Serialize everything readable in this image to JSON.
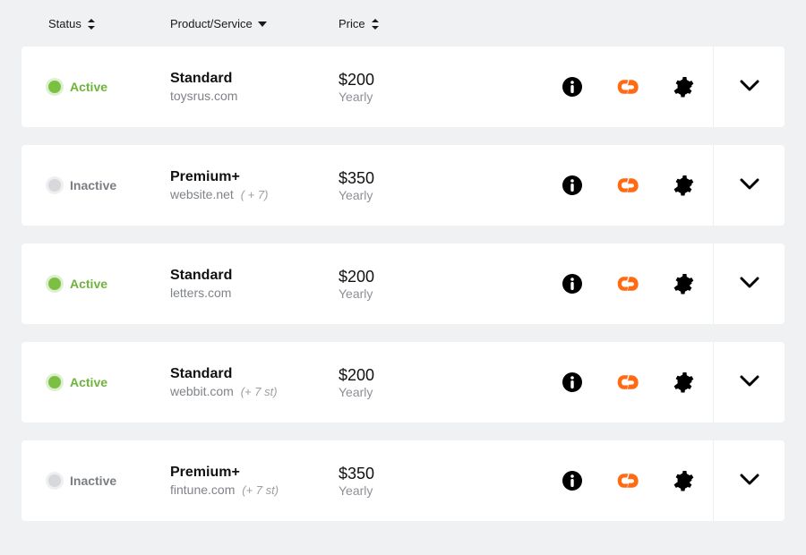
{
  "columns": {
    "status": "Status",
    "product": "Product/Service",
    "price": "Price"
  },
  "rows": [
    {
      "status": "active",
      "status_label": "Active",
      "product": "Standard",
      "domain": "toysrus.com",
      "extra": "",
      "price": "$200",
      "period": "Yearly"
    },
    {
      "status": "inactive",
      "status_label": "Inactive",
      "product": "Premium+",
      "domain": "website.net",
      "extra": "( + 7)",
      "price": "$350",
      "period": "Yearly"
    },
    {
      "status": "active",
      "status_label": "Active",
      "product": "Standard",
      "domain": "letters.com",
      "extra": "",
      "price": "$200",
      "period": "Yearly"
    },
    {
      "status": "active",
      "status_label": "Active",
      "product": "Standard",
      "domain": "webbit.com",
      "extra": "(+ 7 st)",
      "price": "$200",
      "period": "Yearly"
    },
    {
      "status": "inactive",
      "status_label": "Inactive",
      "product": "Premium+",
      "domain": "fintune.com",
      "extra": "(+ 7 st)",
      "price": "$350",
      "period": "Yearly"
    }
  ]
}
